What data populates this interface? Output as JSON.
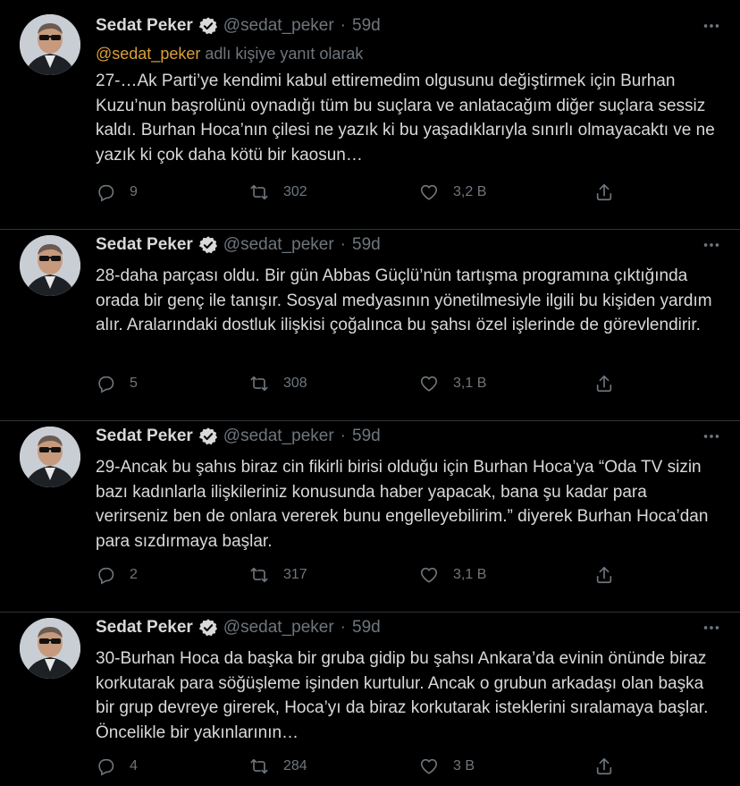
{
  "colors": {
    "background": "#000000",
    "text": "#d9d9d9",
    "muted": "#6e767d",
    "mention": "#d9a03a",
    "divider": "#2f3336"
  },
  "tweets": [
    {
      "name": "Sedat Peker",
      "handle": "@sedat_peker",
      "dot": "·",
      "time": "59d",
      "reply_mention": "@sedat_peker",
      "reply_suffix": " adlı kişiye yanıt olarak",
      "text": "27-…Ak Parti’ye kendimi kabul ettiremedim olgusunu değiştirmek için Burhan Kuzu’nun başrolünü oynadığı tüm bu suçlara ve anlatacağım diğer suçlara sessiz kaldı. Burhan Hoca’nın çilesi ne yazık ki bu yaşadıklarıyla sınırlı olmayacaktı ve ne yazık ki çok daha kötü bir kaosun…",
      "replies": "9",
      "retweets": "302",
      "likes": "3,2 B"
    },
    {
      "name": "Sedat Peker",
      "handle": "@sedat_peker",
      "dot": "·",
      "time": "59d",
      "text": "28-daha parçası oldu. Bir gün Abbas Güçlü’nün tartışma programına çıktığında orada bir genç ile tanışır. Sosyal medyasının yönetilmesiyle ilgili bu kişiden yardım alır. Aralarındaki dostluk ilişkisi çoğalınca bu şahsı özel işlerinde de görevlendirir.",
      "replies": "5",
      "retweets": "308",
      "likes": "3,1 B"
    },
    {
      "name": "Sedat Peker",
      "handle": "@sedat_peker",
      "dot": "·",
      "time": "59d",
      "text": "29-Ancak bu şahıs biraz cin fikirli birisi olduğu için Burhan Hoca’ya “Oda TV sizin bazı kadınlarla ilişkileriniz konusunda haber yapacak, bana şu kadar para verirseniz ben de onlara vererek bunu engelleyebilirim.” diyerek Burhan Hoca’dan para sızdırmaya başlar.",
      "replies": "2",
      "retweets": "317",
      "likes": "3,1 B"
    },
    {
      "name": "Sedat Peker",
      "handle": "@sedat_peker",
      "dot": "·",
      "time": "59d",
      "text": "30-Burhan Hoca da başka bir gruba gidip bu şahsı Ankara’da evinin önünde biraz korkutarak para söğüşleme işinden kurtulur. Ancak o grubun arkadaşı olan başka bir grup devreye girerek, Hoca’yı da biraz korkutarak isteklerini sıralamaya başlar. Öncelikle bir yakınlarının…",
      "replies": "4",
      "retweets": "284",
      "likes": "3 B"
    }
  ]
}
